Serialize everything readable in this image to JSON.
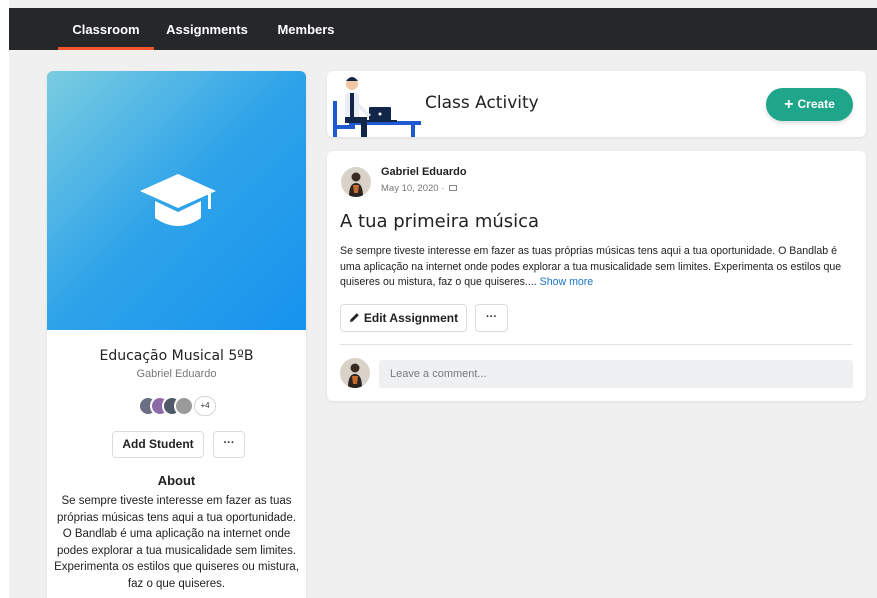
{
  "nav": {
    "tabs": [
      {
        "label": "Classroom",
        "active": true
      },
      {
        "label": "Assignments",
        "active": false
      },
      {
        "label": "Members",
        "active": false
      }
    ]
  },
  "class_card": {
    "icon": "graduation-cap-icon",
    "title": "Educação Musical 5ºB",
    "owner": "Gabriel Eduardo",
    "members_more": "+4",
    "add_student_label": "Add Student",
    "more_label": "···",
    "about_heading": "About",
    "about_text": "Se sempre tiveste interesse em fazer as tuas próprias músicas tens aqui a tua oportunidade. O Bandlab é uma aplicação na internet onde podes explorar a tua musicalidade sem limites. Experimenta os estilos que quiseres ou mistura, faz o que quiseres."
  },
  "activity": {
    "title": "Class Activity",
    "create_label": "Create",
    "create_icon": "plus-icon"
  },
  "post": {
    "author": "Gabriel Eduardo",
    "date": "May 10, 2020 ·",
    "title": "A tua primeira música",
    "body": "Se sempre tiveste interesse em fazer as tuas próprias músicas tens aqui a tua oportunidade. O Bandlab é uma aplicação na internet onde podes explorar a tua musicalidade sem limites. Experimenta os estilos que quiseres ou mistura, faz o que quiseres.... ",
    "show_more": "Show more",
    "edit_label": "Edit Assignment",
    "more_label": "···"
  },
  "comment": {
    "placeholder": "Leave a comment..."
  },
  "colors": {
    "topbar": "#26272b",
    "tab_active_underline": "#f2542d",
    "accent_green": "#1fa58a",
    "link_blue": "#1b73c9",
    "hero_blue": "#1793ee"
  }
}
